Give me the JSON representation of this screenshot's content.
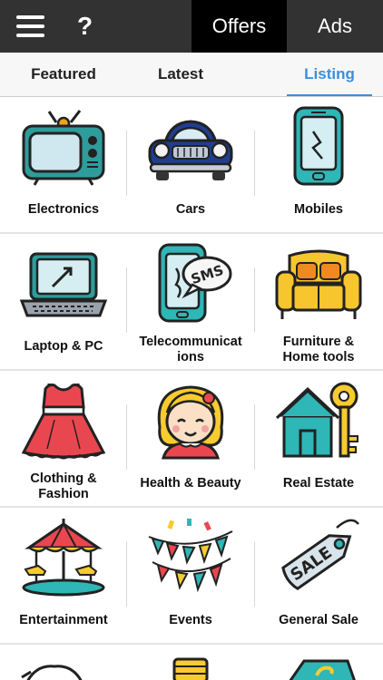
{
  "header": {
    "tabs": [
      {
        "label": "Offers",
        "active": true
      },
      {
        "label": "Ads",
        "active": false
      }
    ],
    "help_label": "?"
  },
  "subtabs": [
    {
      "label": "Featured"
    },
    {
      "label": "Latest"
    },
    {
      "label": "Listing",
      "active": true
    }
  ],
  "colors": {
    "header_bg": "#323232",
    "active_tab_bg": "#000000",
    "accent": "#3b8fd9"
  },
  "categories": [
    {
      "label": "Electronics",
      "icon": "tv-icon"
    },
    {
      "label": "Cars",
      "icon": "car-icon"
    },
    {
      "label": "Mobiles",
      "icon": "mobile-phone-icon"
    },
    {
      "label": "Laptop & PC",
      "icon": "laptop-icon"
    },
    {
      "label": "Telecommunications",
      "label_lines": [
        "Telecommunicat",
        "ions"
      ],
      "icon": "sms-phone-icon"
    },
    {
      "label": "Furniture & Home tools",
      "label_lines": [
        "Furniture &",
        "Home tools"
      ],
      "icon": "sofa-icon"
    },
    {
      "label": "Clothing & Fashion",
      "label_lines": [
        "Clothing &",
        "Fashion"
      ],
      "icon": "dress-icon"
    },
    {
      "label": "Health & Beauty",
      "icon": "girl-face-icon"
    },
    {
      "label": "Real Estate",
      "icon": "house-key-icon"
    },
    {
      "label": "Entertainment",
      "icon": "carousel-icon"
    },
    {
      "label": "Events",
      "icon": "bunting-icon"
    },
    {
      "label": "General Sale",
      "icon": "sale-tag-icon"
    }
  ]
}
